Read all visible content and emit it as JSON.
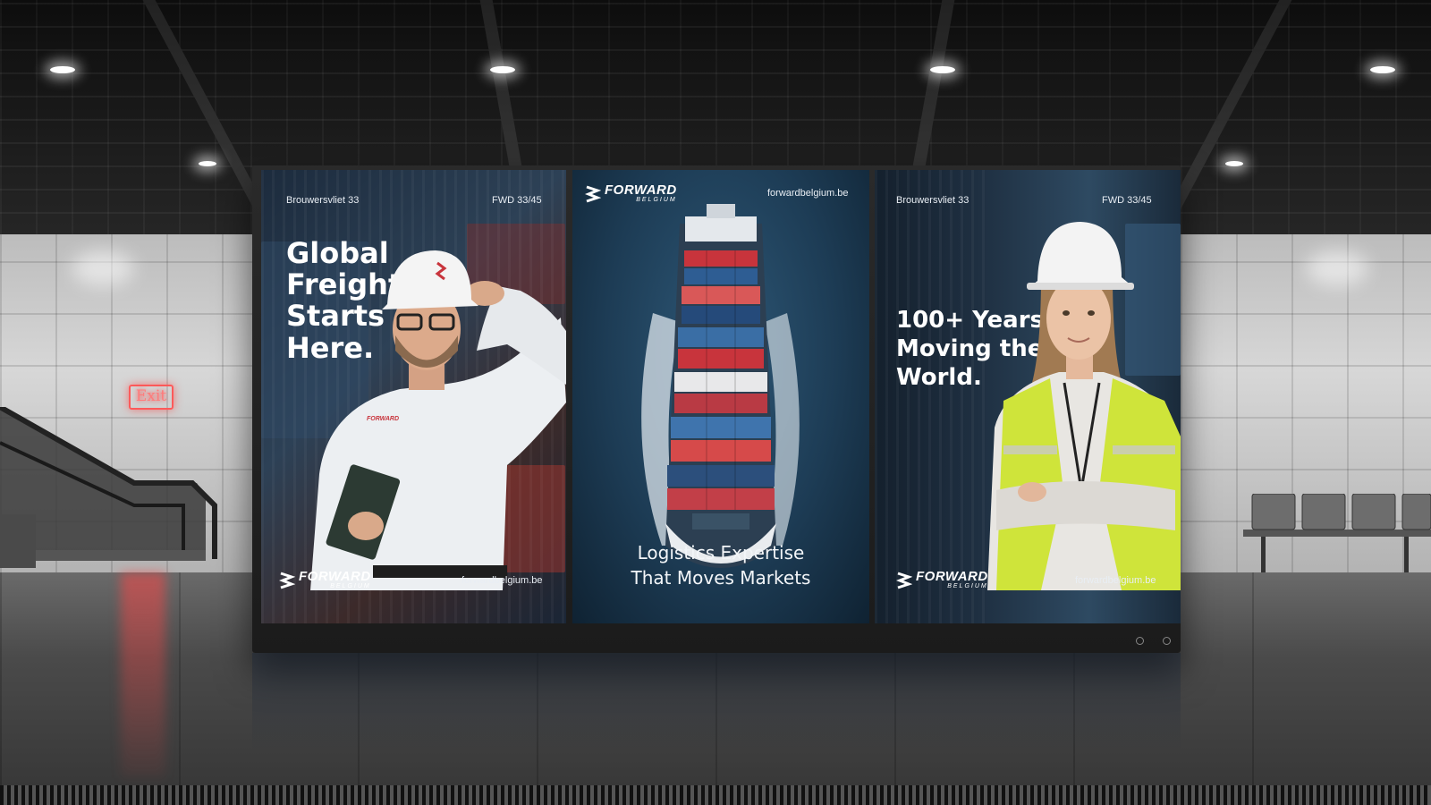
{
  "scene": {
    "exit_sign": "Exit"
  },
  "panels": {
    "left": {
      "address": "Brouwersvliet 33",
      "code": "FWD 33/45",
      "headline": [
        "Global",
        "Freight",
        "Starts",
        "Here."
      ],
      "brand_name": "FORWARD",
      "brand_sub": "BELGIUM",
      "website": "forwardbelgium.be",
      "shirt_logo": "FORWARD"
    },
    "center": {
      "brand_name": "FORWARD",
      "brand_sub": "BELGIUM",
      "website": "forwardbelgium.be",
      "tagline": [
        "Logistics Expertise",
        "That Moves Markets"
      ]
    },
    "right": {
      "address": "Brouwersvliet 33",
      "code": "FWD 33/45",
      "headline": [
        "100+ Years",
        "Moving the",
        "World."
      ],
      "brand_name": "FORWARD",
      "brand_sub": "BELGIUM",
      "website": "forwardbelgium.be"
    }
  },
  "colors": {
    "accent_red": "#c8343c",
    "vest_yellow": "#cfe43a",
    "ship_blue": "#1d3c55"
  }
}
